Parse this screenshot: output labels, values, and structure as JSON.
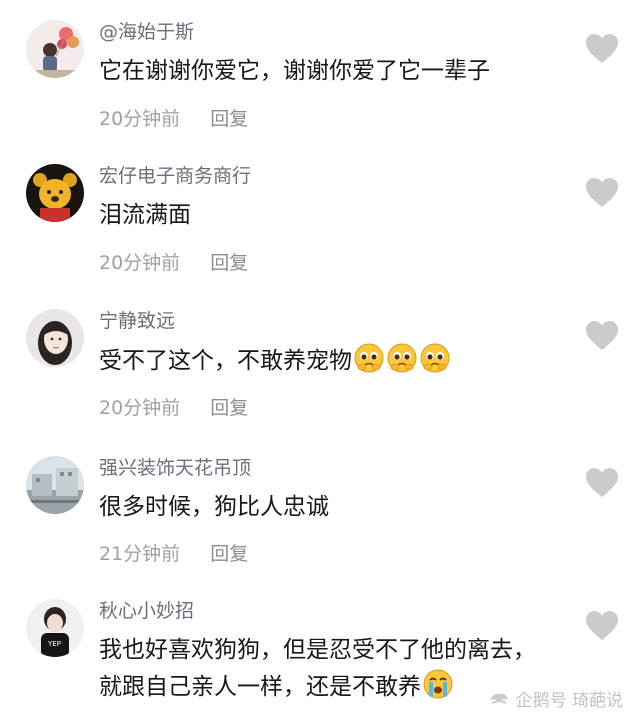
{
  "comments": [
    {
      "username": "@海始于斯",
      "text": "它在谢谢你爱它，谢谢你爱了它一辈子",
      "time": "20分钟前",
      "reply": "回复",
      "avatar_icon": "balloon-girl-avatar"
    },
    {
      "username": "宏仔电子商务商行",
      "text": "泪流满面",
      "time": "20分钟前",
      "reply": "回复",
      "avatar_icon": "pooh-bear-avatar"
    },
    {
      "username": "宁静致远",
      "text": "受不了这个，不敢养宠物",
      "time": "20分钟前",
      "reply": "回复",
      "avatar_icon": "girl-portrait-avatar"
    },
    {
      "username": "强兴装饰天花吊顶",
      "text": "很多时候，狗比人忠诚",
      "time": "21分钟前",
      "reply": "回复",
      "avatar_icon": "building-avatar"
    },
    {
      "username": "秋心小妙招",
      "text_line1": "我也好喜欢狗狗，但是忍受不了他的离去，",
      "text_line2": "就跟自己亲人一样，还是不敢养",
      "time": "",
      "reply": "",
      "avatar_icon": "girl-black-shirt-avatar"
    }
  ],
  "watermark": {
    "text": "企鹅号 琦葩说"
  },
  "colors": {
    "heart": "#c9cbcf",
    "username": "#6b6f7b",
    "meta": "#9ea1a8"
  },
  "icons": {
    "like": "heart-icon",
    "pleading_emoji": "pleading-face-emoji",
    "crying_emoji": "crying-face-emoji"
  }
}
